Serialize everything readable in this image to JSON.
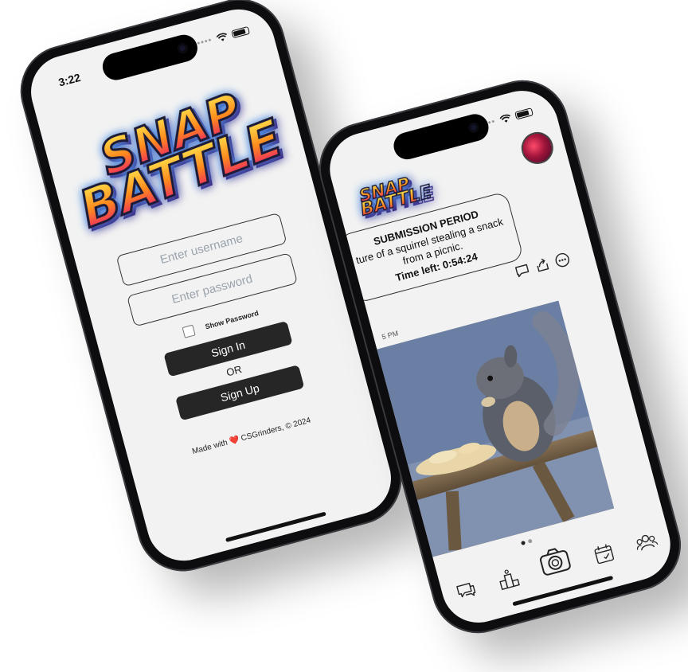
{
  "phone_signin": {
    "status_time": "3:22",
    "logo": {
      "line1": "SNAP",
      "line2": "BATTLE"
    },
    "username_placeholder": "Enter username",
    "password_placeholder": "Enter password",
    "show_password_label": "Show Password",
    "sign_in_label": "Sign In",
    "or_label": "OR",
    "sign_up_label": "Sign Up",
    "footer": {
      "prefix": "Made with",
      "heart": "❤️",
      "suffix": "CSGrinders, © 2024"
    }
  },
  "phone_submission": {
    "logo": {
      "line1": "SNAP",
      "line2": "BATTLE"
    },
    "prompt": {
      "title": "SUBMISSION PERIOD",
      "text": "ture of a squirrel stealing a snack from a picnic.",
      "time_left": "Time left: 0:54:24"
    },
    "post_time": "5 PM",
    "actions": [
      "comment-icon",
      "share-icon",
      "more-icon"
    ],
    "page_dots": {
      "count": 2,
      "active": 0
    },
    "tabs": [
      "chat-icon",
      "leaderboard-icon",
      "camera-icon",
      "calendar-icon",
      "friends-icon"
    ]
  },
  "colors": {
    "button": "#262626",
    "screen": "#f2f2f2",
    "heart": "#e02424"
  }
}
